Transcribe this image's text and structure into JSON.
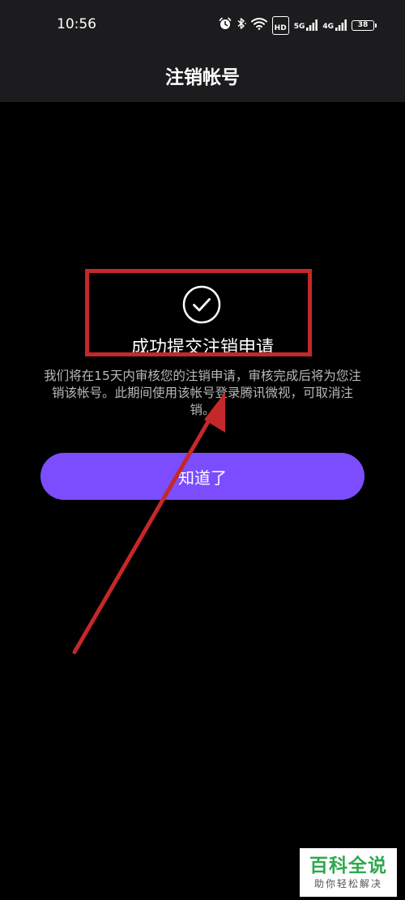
{
  "status_bar": {
    "time": "10:56",
    "network_5g": "5G",
    "network_4g": "4G",
    "hd": "HD",
    "battery": "38",
    "icons": [
      "alarm-icon",
      "bluetooth-icon",
      "wifi-icon",
      "hd-icon",
      "signal-5g-icon",
      "signal-4g-icon",
      "battery-icon"
    ]
  },
  "header": {
    "title": "注销帐号"
  },
  "main": {
    "success_title": "成功提交注销申请",
    "description": "我们将在15天内审核您的注销申请，审核完成后将为您注销该帐号。此期间使用该帐号登录腾讯微视，可取消注销。",
    "ok_label": "知道了"
  },
  "colors": {
    "background": "#000000",
    "bar_background": "#1c1c1e",
    "accent": "#7b4dff",
    "annotation": "#c5282a",
    "watermark_green": "#2fa84f"
  },
  "watermark": {
    "main": "百科全说",
    "sub": "助你轻松解决"
  }
}
